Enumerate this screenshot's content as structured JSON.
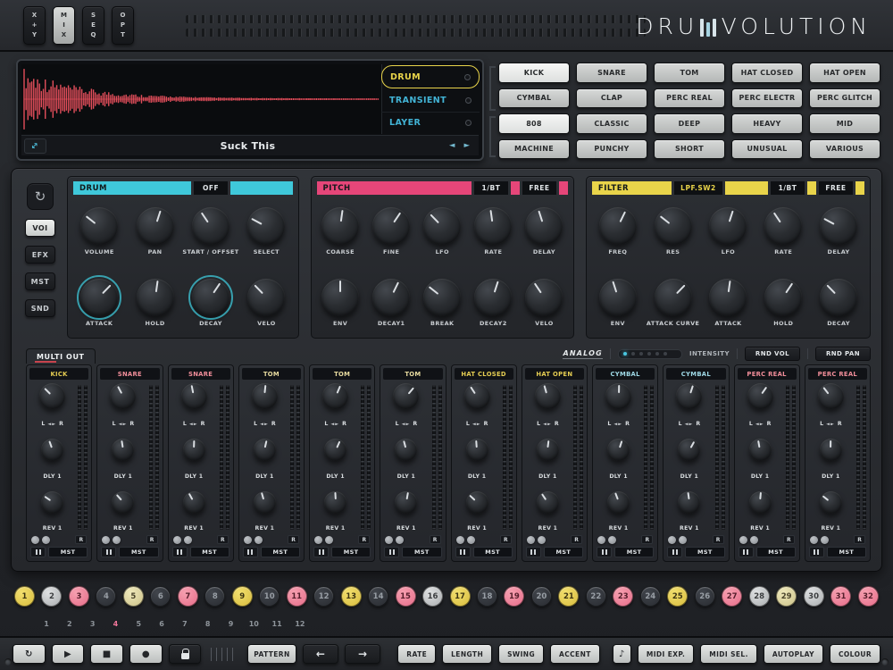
{
  "app": {
    "logo_pre": "DRU",
    "logo_post": "VOLUTION"
  },
  "topnav": [
    {
      "label": "X+Y",
      "active": false
    },
    {
      "label": "MIX",
      "active": true
    },
    {
      "label": "SEQ",
      "active": false
    },
    {
      "label": "OPT",
      "active": false
    }
  ],
  "sample": {
    "tabs": [
      {
        "label": "DRUM",
        "active": true
      },
      {
        "label": "TRANSIENT",
        "active": false
      },
      {
        "label": "LAYER",
        "active": false
      }
    ],
    "name": "Suck This",
    "fit_icon": "↔",
    "prev_icon": "◄",
    "next_icon": "►"
  },
  "categories": [
    {
      "label": "KICK",
      "active": true
    },
    {
      "label": "SNARE",
      "active": false
    },
    {
      "label": "TOM",
      "active": false
    },
    {
      "label": "HAT CLOSED",
      "active": false
    },
    {
      "label": "HAT OPEN",
      "active": false
    },
    {
      "label": "CYMBAL",
      "active": false
    },
    {
      "label": "CLAP",
      "active": false
    },
    {
      "label": "PERC REAL",
      "active": false
    },
    {
      "label": "PERC ELECTR",
      "active": false
    },
    {
      "label": "PERC GLITCH",
      "active": false
    },
    {
      "label": "808",
      "active": true
    },
    {
      "label": "CLASSIC",
      "active": false
    },
    {
      "label": "DEEP",
      "active": false
    },
    {
      "label": "HEAVY",
      "active": false
    },
    {
      "label": "MID",
      "active": false
    },
    {
      "label": "MACHINE",
      "active": false
    },
    {
      "label": "PUNCHY",
      "active": false
    },
    {
      "label": "SHORT",
      "active": false
    },
    {
      "label": "UNUSUAL",
      "active": false
    },
    {
      "label": "VARIOUS",
      "active": false
    }
  ],
  "side_buttons": [
    {
      "label": "VOI",
      "active": true
    },
    {
      "label": "EFX",
      "active": false
    },
    {
      "label": "MST",
      "active": false
    },
    {
      "label": "SND",
      "active": false
    }
  ],
  "panels": [
    {
      "name": "DRUM",
      "color": "#3fc8da",
      "header": [
        {
          "text": "DRUM",
          "type": "color",
          "grow": 2.2
        },
        {
          "text": "OFF",
          "type": "dark",
          "grow": 0
        },
        {
          "text": "",
          "type": "color",
          "grow": 1.4
        }
      ],
      "knob_rows": [
        [
          {
            "label": "VOLUME"
          },
          {
            "label": "PAN"
          },
          {
            "label": "START / OFFSET"
          },
          {
            "label": "SELECT"
          }
        ],
        [
          {
            "label": "ATTACK",
            "ring": true
          },
          {
            "label": "HOLD"
          },
          {
            "label": "DECAY",
            "ring": true
          },
          {
            "label": "VELO"
          }
        ]
      ]
    },
    {
      "name": "PITCH",
      "color": "#e64679",
      "header": [
        {
          "text": "PITCH",
          "type": "color",
          "grow": 4
        },
        {
          "text": "1/BT",
          "type": "dark",
          "grow": 0
        },
        {
          "text": "",
          "type": "color",
          "grow": 0,
          "small": true
        },
        {
          "text": "FREE",
          "type": "dark",
          "grow": 0
        },
        {
          "text": "",
          "type": "color",
          "grow": 0,
          "small": true
        }
      ],
      "knob_rows": [
        [
          {
            "label": "COARSE"
          },
          {
            "label": "FINE"
          },
          {
            "label": "LFO"
          },
          {
            "label": "RATE"
          },
          {
            "label": "DELAY"
          }
        ],
        [
          {
            "label": "ENV"
          },
          {
            "label": "DECAY1"
          },
          {
            "label": "BREAK"
          },
          {
            "label": "DECAY2"
          },
          {
            "label": "VELO"
          }
        ]
      ]
    },
    {
      "name": "FILTER",
      "color": "#e9d44a",
      "header": [
        {
          "text": "FILTER",
          "type": "color",
          "grow": 1.2
        },
        {
          "text": "LPF.SW2",
          "type": "dark-accent",
          "grow": 0
        },
        {
          "text": "",
          "type": "color",
          "grow": 1
        },
        {
          "text": "1/BT",
          "type": "dark",
          "grow": 0
        },
        {
          "text": "",
          "type": "color",
          "grow": 0,
          "small": true
        },
        {
          "text": "FREE",
          "type": "dark",
          "grow": 0
        },
        {
          "text": "",
          "type": "color",
          "grow": 0,
          "small": true
        }
      ],
      "knob_rows": [
        [
          {
            "label": "FREQ"
          },
          {
            "label": "RES"
          },
          {
            "label": "LFO"
          },
          {
            "label": "RATE"
          },
          {
            "label": "DELAY"
          }
        ],
        [
          {
            "label": "ENV"
          },
          {
            "label": "ATTACK CURVE"
          },
          {
            "label": "ATTACK"
          },
          {
            "label": "HOLD"
          },
          {
            "label": "DECAY"
          }
        ]
      ]
    }
  ],
  "mixer": {
    "tab_label": "MULTI OUT",
    "analog_label": "ANALOG",
    "intensity_label": "INTENSITY",
    "rnd_vol_label": "RND VOL",
    "rnd_pan_label": "RND PAN",
    "pan_left": "L",
    "pan_right": "R",
    "pan_icon": "◄►",
    "delay_label": "DLY 1",
    "reverb_label": "REV 1",
    "route_label": "R",
    "master_label": "MST",
    "strips": [
      {
        "name": "KICK",
        "color": "#e5cd52"
      },
      {
        "name": "SNARE",
        "color": "#f28e9a"
      },
      {
        "name": "SNARE",
        "color": "#f28e9a"
      },
      {
        "name": "TOM",
        "color": "#e9dca0"
      },
      {
        "name": "TOM",
        "color": "#e9dca0"
      },
      {
        "name": "TOM",
        "color": "#e9dca0"
      },
      {
        "name": "HAT CLOSED",
        "color": "#e5cd52"
      },
      {
        "name": "HAT OPEN",
        "color": "#e5cd52"
      },
      {
        "name": "CYMBAL",
        "color": "#9fd9e6"
      },
      {
        "name": "CYMBAL",
        "color": "#9fd9e6"
      },
      {
        "name": "PERC REAL",
        "color": "#f28e9a"
      },
      {
        "name": "PERC REAL",
        "color": "#f28e9a"
      }
    ]
  },
  "sequencer": {
    "steps": [
      {
        "n": 1,
        "state": "yellow"
      },
      {
        "n": 2,
        "state": "silver"
      },
      {
        "n": 3,
        "state": "pink"
      },
      {
        "n": 4,
        "state": "off"
      },
      {
        "n": 5,
        "state": "paleyellow"
      },
      {
        "n": 6,
        "state": "off"
      },
      {
        "n": 7,
        "state": "pink"
      },
      {
        "n": 8,
        "state": "off"
      },
      {
        "n": 9,
        "state": "yellow"
      },
      {
        "n": 10,
        "state": "off"
      },
      {
        "n": 11,
        "state": "pink"
      },
      {
        "n": 12,
        "state": "off"
      },
      {
        "n": 13,
        "state": "yellow"
      },
      {
        "n": 14,
        "state": "off"
      },
      {
        "n": 15,
        "state": "pink"
      },
      {
        "n": 16,
        "state": "silver"
      },
      {
        "n": 17,
        "state": "yellow"
      },
      {
        "n": 18,
        "state": "off"
      },
      {
        "n": 19,
        "state": "pink"
      },
      {
        "n": 20,
        "state": "off"
      },
      {
        "n": 21,
        "state": "yellow"
      },
      {
        "n": 22,
        "state": "off"
      },
      {
        "n": 23,
        "state": "pink"
      },
      {
        "n": 24,
        "state": "off"
      },
      {
        "n": 25,
        "state": "yellow"
      },
      {
        "n": 26,
        "state": "off"
      },
      {
        "n": 27,
        "state": "pink"
      },
      {
        "n": 28,
        "state": "silver"
      },
      {
        "n": 29,
        "state": "paleyellow"
      },
      {
        "n": 30,
        "state": "silver"
      },
      {
        "n": 31,
        "state": "pink"
      },
      {
        "n": 32,
        "state": "pink"
      }
    ],
    "pattern_numbers": [
      "1",
      "2",
      "3",
      "4",
      "5",
      "6",
      "7",
      "8",
      "9",
      "10",
      "11",
      "12"
    ],
    "active_pattern": "4"
  },
  "transport": {
    "loop_icon": "↻",
    "play_icon": "▶",
    "stop_icon": "■",
    "record_icon": "●",
    "pattern_label": "PATTERN",
    "prev_icon": "←",
    "next_icon": "→",
    "buttons_mid": [
      "RATE",
      "LENGTH",
      "SWING",
      "ACCENT"
    ],
    "note_icon": "♪",
    "buttons_right": [
      "MIDI EXP.",
      "MIDI SEL.",
      "AUTOPLAY",
      "COLOUR"
    ]
  }
}
